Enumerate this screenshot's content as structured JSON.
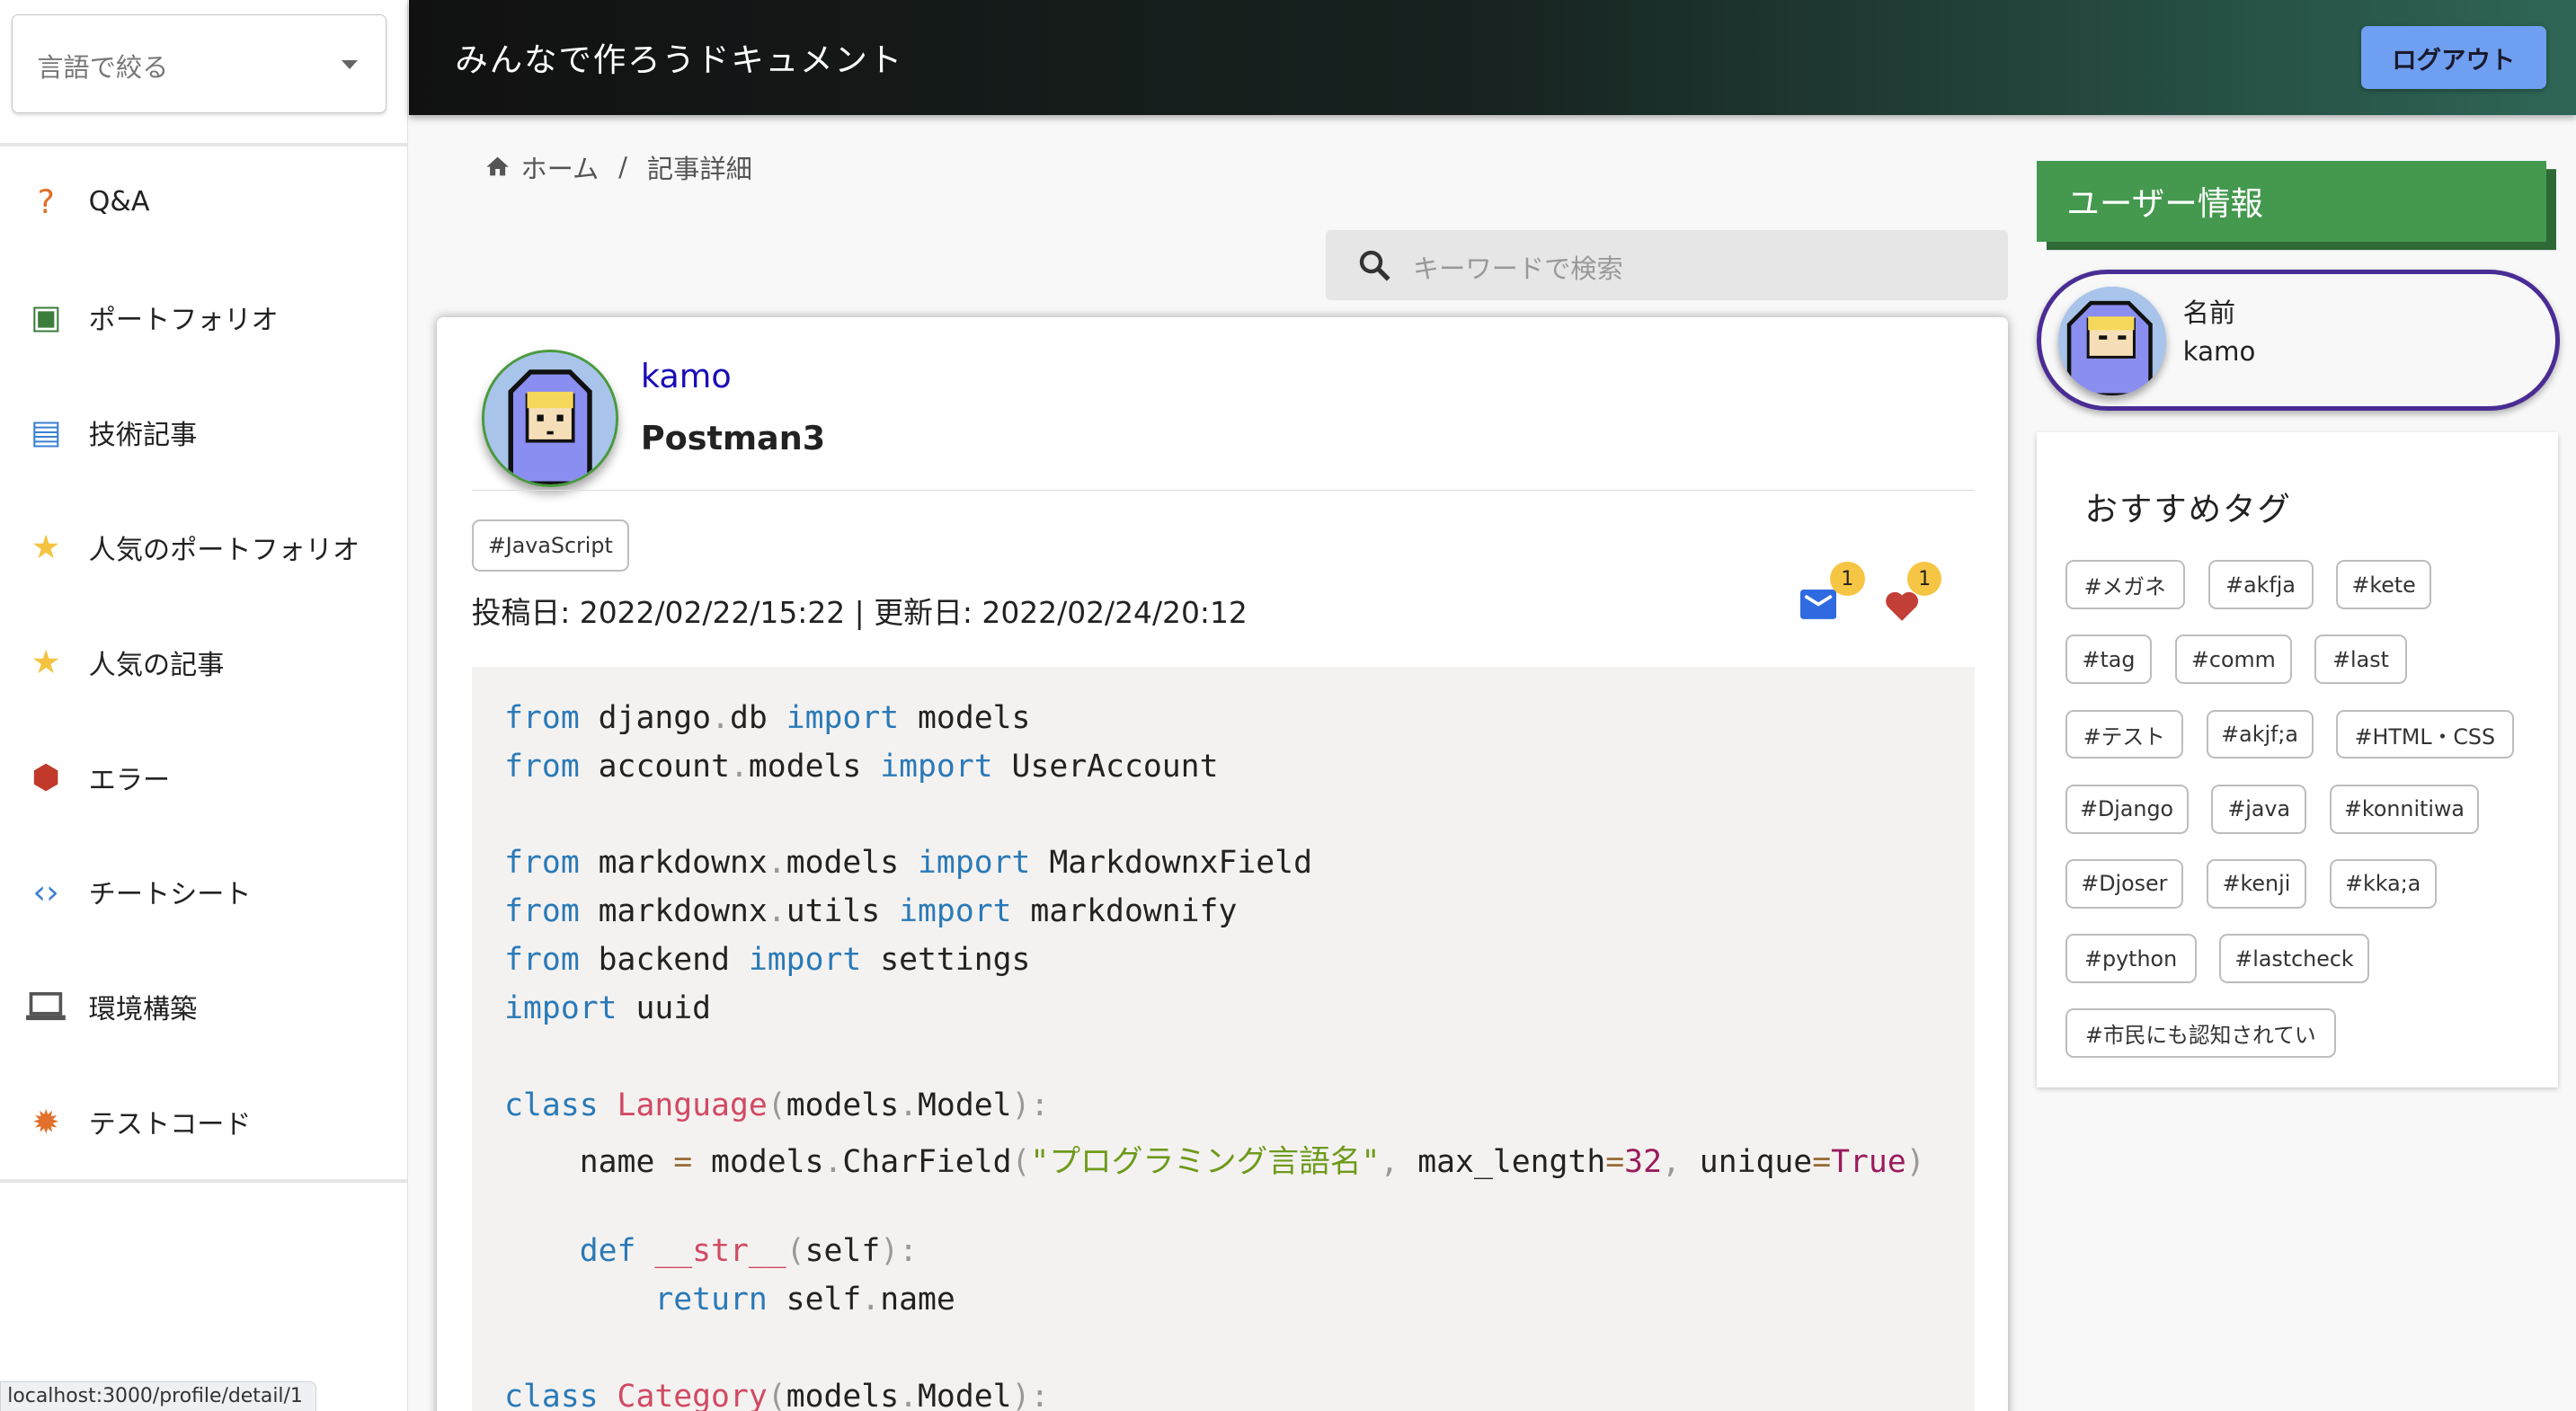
{
  "sidebar": {
    "filter_placeholder": "言語で絞る",
    "items": [
      {
        "label": "Q&A",
        "icon": "question-icon",
        "color": "#e0702a"
      },
      {
        "label": "ポートフォリオ",
        "icon": "portfolio-icon",
        "color": "#3b7d3b"
      },
      {
        "label": "技術記事",
        "icon": "article-icon",
        "color": "#3a7fd0"
      },
      {
        "label": "人気のポートフォリオ",
        "icon": "star-icon",
        "color": "#f5c342"
      },
      {
        "label": "人気の記事",
        "icon": "star-icon",
        "color": "#f5c342"
      },
      {
        "label": "エラー",
        "icon": "error-icon",
        "color": "#c0392b"
      },
      {
        "label": "チートシート",
        "icon": "code-icon",
        "color": "#3a7fd0"
      },
      {
        "label": "環境構築",
        "icon": "laptop-icon",
        "color": "#555555"
      },
      {
        "label": "テストコード",
        "icon": "bug-icon",
        "color": "#e0702a"
      }
    ]
  },
  "header": {
    "title": "みんなで作ろうドキュメント",
    "logout_label": "ログアウト"
  },
  "breadcrumb": {
    "home": "ホーム",
    "separator": "/",
    "current": "記事詳細"
  },
  "search": {
    "placeholder": "キーワードで検索"
  },
  "article": {
    "author": "kamo",
    "title": "Postman3",
    "tag": "#JavaScript",
    "dates": "投稿日: 2022/02/22/15:22 | 更新日: 2022/02/24/20:12",
    "mail_count": "1",
    "like_count": "1",
    "code": [
      [
        [
          "kw",
          "from"
        ],
        [
          "",
          " django"
        ],
        [
          "p",
          "."
        ],
        [
          "",
          "db "
        ],
        [
          "kw",
          "import"
        ],
        [
          "",
          " models"
        ]
      ],
      [
        [
          "kw",
          "from"
        ],
        [
          "",
          " account"
        ],
        [
          "p",
          "."
        ],
        [
          "",
          "models "
        ],
        [
          "kw",
          "import"
        ],
        [
          "",
          " UserAccount"
        ]
      ],
      [],
      [
        [
          "kw",
          "from"
        ],
        [
          "",
          " markdownx"
        ],
        [
          "p",
          "."
        ],
        [
          "",
          "models "
        ],
        [
          "kw",
          "import"
        ],
        [
          "",
          " MarkdownxField"
        ]
      ],
      [
        [
          "kw",
          "from"
        ],
        [
          "",
          " markdownx"
        ],
        [
          "p",
          "."
        ],
        [
          "",
          "utils "
        ],
        [
          "kw",
          "import"
        ],
        [
          "",
          " markdownify"
        ]
      ],
      [
        [
          "kw",
          "from"
        ],
        [
          "",
          " backend "
        ],
        [
          "kw",
          "import"
        ],
        [
          "",
          " settings"
        ]
      ],
      [
        [
          "kw",
          "import"
        ],
        [
          "",
          " uuid"
        ]
      ],
      [],
      [
        [
          "kw",
          "class"
        ],
        [
          "",
          " "
        ],
        [
          "cls",
          "Language"
        ],
        [
          "p",
          "("
        ],
        [
          "",
          "models"
        ],
        [
          "p",
          "."
        ],
        [
          "",
          "Model"
        ],
        [
          "p",
          "):"
        ]
      ],
      [
        [
          "",
          "    name "
        ],
        [
          "op",
          "="
        ],
        [
          "",
          " models"
        ],
        [
          "p",
          "."
        ],
        [
          "",
          "CharField"
        ],
        [
          "p",
          "("
        ],
        [
          "str",
          "\"プログラミング言語名\""
        ],
        [
          "p",
          ","
        ],
        [
          "",
          " max_length"
        ],
        [
          "op",
          "="
        ],
        [
          "num",
          "32"
        ],
        [
          "p",
          ","
        ],
        [
          "",
          " unique"
        ],
        [
          "op",
          "="
        ],
        [
          "num",
          "True"
        ],
        [
          "p",
          ")"
        ]
      ],
      [],
      [
        [
          "",
          "    "
        ],
        [
          "kw",
          "def"
        ],
        [
          "",
          " "
        ],
        [
          "cls",
          "__str__"
        ],
        [
          "p",
          "("
        ],
        [
          "",
          "self"
        ],
        [
          "p",
          "):"
        ]
      ],
      [
        [
          "",
          "        "
        ],
        [
          "kw",
          "return"
        ],
        [
          "",
          " self"
        ],
        [
          "p",
          "."
        ],
        [
          "",
          "name"
        ]
      ],
      [],
      [
        [
          "kw",
          "class"
        ],
        [
          "",
          " "
        ],
        [
          "cls",
          "Category"
        ],
        [
          "p",
          "("
        ],
        [
          "",
          "models"
        ],
        [
          "p",
          "."
        ],
        [
          "",
          "Model"
        ],
        [
          "p",
          "):"
        ]
      ]
    ]
  },
  "user_info": {
    "heading": "ユーザー情報",
    "name_label": "名前",
    "name": "kamo"
  },
  "tags": {
    "heading": "おすすめタグ",
    "rows": [
      [
        "#メガネ",
        "#akfja",
        "#kete"
      ],
      [
        "#tag",
        "#comm",
        "#last"
      ],
      [
        "#テスト",
        "#akjf;a",
        "#HTML・CSS"
      ],
      [
        "#Django",
        "#java",
        "#konnitiwa"
      ],
      [
        "#Djoser",
        "#kenji",
        "#kka;a"
      ],
      [
        "#python",
        "#lastcheck"
      ],
      [
        "#市民にも認知されてい"
      ]
    ]
  },
  "status_url": "localhost:3000/profile/detail/1",
  "colors": {
    "accent_green": "#44994f",
    "logout_blue": "#6f9ff0",
    "pill_border": "#4a2c95",
    "author_link": "#1a0db5"
  }
}
